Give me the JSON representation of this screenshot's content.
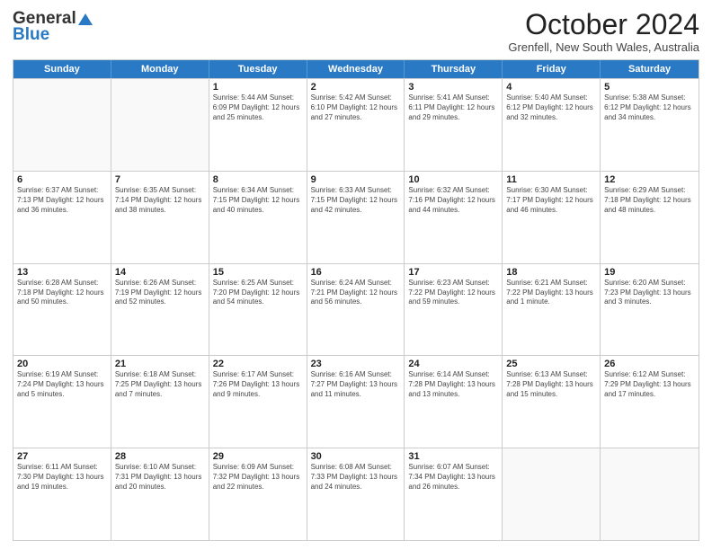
{
  "logo": {
    "general": "General",
    "blue": "Blue"
  },
  "title": "October 2024",
  "subtitle": "Grenfell, New South Wales, Australia",
  "days_of_week": [
    "Sunday",
    "Monday",
    "Tuesday",
    "Wednesday",
    "Thursday",
    "Friday",
    "Saturday"
  ],
  "weeks": [
    [
      {
        "day": "",
        "info": ""
      },
      {
        "day": "",
        "info": ""
      },
      {
        "day": "1",
        "info": "Sunrise: 5:44 AM\nSunset: 6:09 PM\nDaylight: 12 hours and 25 minutes."
      },
      {
        "day": "2",
        "info": "Sunrise: 5:42 AM\nSunset: 6:10 PM\nDaylight: 12 hours and 27 minutes."
      },
      {
        "day": "3",
        "info": "Sunrise: 5:41 AM\nSunset: 6:11 PM\nDaylight: 12 hours and 29 minutes."
      },
      {
        "day": "4",
        "info": "Sunrise: 5:40 AM\nSunset: 6:12 PM\nDaylight: 12 hours and 32 minutes."
      },
      {
        "day": "5",
        "info": "Sunrise: 5:38 AM\nSunset: 6:12 PM\nDaylight: 12 hours and 34 minutes."
      }
    ],
    [
      {
        "day": "6",
        "info": "Sunrise: 6:37 AM\nSunset: 7:13 PM\nDaylight: 12 hours and 36 minutes."
      },
      {
        "day": "7",
        "info": "Sunrise: 6:35 AM\nSunset: 7:14 PM\nDaylight: 12 hours and 38 minutes."
      },
      {
        "day": "8",
        "info": "Sunrise: 6:34 AM\nSunset: 7:15 PM\nDaylight: 12 hours and 40 minutes."
      },
      {
        "day": "9",
        "info": "Sunrise: 6:33 AM\nSunset: 7:15 PM\nDaylight: 12 hours and 42 minutes."
      },
      {
        "day": "10",
        "info": "Sunrise: 6:32 AM\nSunset: 7:16 PM\nDaylight: 12 hours and 44 minutes."
      },
      {
        "day": "11",
        "info": "Sunrise: 6:30 AM\nSunset: 7:17 PM\nDaylight: 12 hours and 46 minutes."
      },
      {
        "day": "12",
        "info": "Sunrise: 6:29 AM\nSunset: 7:18 PM\nDaylight: 12 hours and 48 minutes."
      }
    ],
    [
      {
        "day": "13",
        "info": "Sunrise: 6:28 AM\nSunset: 7:18 PM\nDaylight: 12 hours and 50 minutes."
      },
      {
        "day": "14",
        "info": "Sunrise: 6:26 AM\nSunset: 7:19 PM\nDaylight: 12 hours and 52 minutes."
      },
      {
        "day": "15",
        "info": "Sunrise: 6:25 AM\nSunset: 7:20 PM\nDaylight: 12 hours and 54 minutes."
      },
      {
        "day": "16",
        "info": "Sunrise: 6:24 AM\nSunset: 7:21 PM\nDaylight: 12 hours and 56 minutes."
      },
      {
        "day": "17",
        "info": "Sunrise: 6:23 AM\nSunset: 7:22 PM\nDaylight: 12 hours and 59 minutes."
      },
      {
        "day": "18",
        "info": "Sunrise: 6:21 AM\nSunset: 7:22 PM\nDaylight: 13 hours and 1 minute."
      },
      {
        "day": "19",
        "info": "Sunrise: 6:20 AM\nSunset: 7:23 PM\nDaylight: 13 hours and 3 minutes."
      }
    ],
    [
      {
        "day": "20",
        "info": "Sunrise: 6:19 AM\nSunset: 7:24 PM\nDaylight: 13 hours and 5 minutes."
      },
      {
        "day": "21",
        "info": "Sunrise: 6:18 AM\nSunset: 7:25 PM\nDaylight: 13 hours and 7 minutes."
      },
      {
        "day": "22",
        "info": "Sunrise: 6:17 AM\nSunset: 7:26 PM\nDaylight: 13 hours and 9 minutes."
      },
      {
        "day": "23",
        "info": "Sunrise: 6:16 AM\nSunset: 7:27 PM\nDaylight: 13 hours and 11 minutes."
      },
      {
        "day": "24",
        "info": "Sunrise: 6:14 AM\nSunset: 7:28 PM\nDaylight: 13 hours and 13 minutes."
      },
      {
        "day": "25",
        "info": "Sunrise: 6:13 AM\nSunset: 7:28 PM\nDaylight: 13 hours and 15 minutes."
      },
      {
        "day": "26",
        "info": "Sunrise: 6:12 AM\nSunset: 7:29 PM\nDaylight: 13 hours and 17 minutes."
      }
    ],
    [
      {
        "day": "27",
        "info": "Sunrise: 6:11 AM\nSunset: 7:30 PM\nDaylight: 13 hours and 19 minutes."
      },
      {
        "day": "28",
        "info": "Sunrise: 6:10 AM\nSunset: 7:31 PM\nDaylight: 13 hours and 20 minutes."
      },
      {
        "day": "29",
        "info": "Sunrise: 6:09 AM\nSunset: 7:32 PM\nDaylight: 13 hours and 22 minutes."
      },
      {
        "day": "30",
        "info": "Sunrise: 6:08 AM\nSunset: 7:33 PM\nDaylight: 13 hours and 24 minutes."
      },
      {
        "day": "31",
        "info": "Sunrise: 6:07 AM\nSunset: 7:34 PM\nDaylight: 13 hours and 26 minutes."
      },
      {
        "day": "",
        "info": ""
      },
      {
        "day": "",
        "info": ""
      }
    ]
  ]
}
